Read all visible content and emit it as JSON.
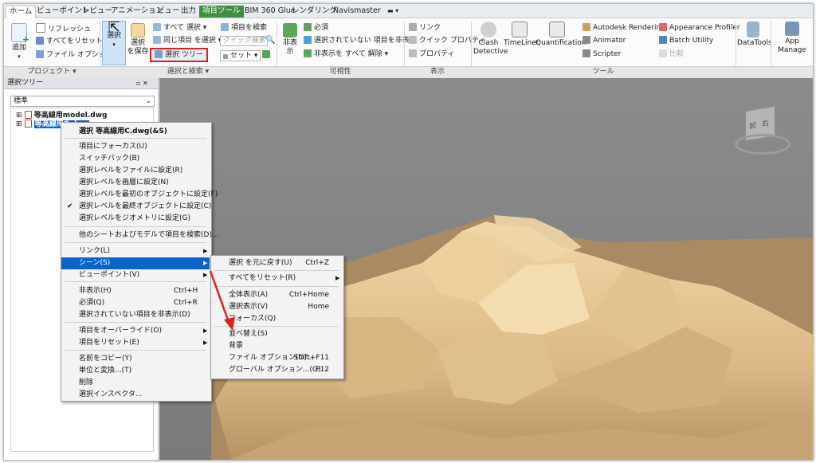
{
  "tabs": [
    "ホーム",
    "ビューポイント",
    "レビュー",
    "アニメーション",
    "ビュー",
    "出力",
    "項目ツール",
    "BIM 360 Glue",
    "レンダリング",
    "Navismaster"
  ],
  "ribbon": {
    "project": {
      "add": "追加",
      "refresh": "リフレッシュ",
      "reset_all": "すべてをリセット",
      "file_options": "ファイル オプション",
      "group": "プロジェクト"
    },
    "select_search": {
      "select": "選択",
      "save_sel_1": "選択",
      "save_sel_2": "を保存",
      "select_all": "すべて 選択",
      "select_same": "同じ項目 を選択",
      "select_tree": "選択 ツリー",
      "find_items": "項目を検索",
      "quick_find_placeholder": "クイック検索",
      "sets": "セット",
      "group": "選択と検索"
    },
    "visibility": {
      "hide": "非表示",
      "required": "必須",
      "hide_unselected": "選択されていない 項目を非表示",
      "unhide_all": "非表示を すべて 解除",
      "group": "可視性"
    },
    "display": {
      "links": "リンク",
      "quick_props": "クイック プロパティ",
      "properties": "プロパティ",
      "group": "表示"
    },
    "tools": {
      "clash": "Clash",
      "detective": "Detective",
      "timeliner": "TimeLiner",
      "quantification": "Quantification",
      "autodesk_rendering": "Autodesk Rendering",
      "animator": "Animator",
      "scripter": "Scripter",
      "appearance_profiler": "Appearance Profiler",
      "batch_utility": "Batch Utility",
      "compare": "比較",
      "group": "ツール"
    },
    "datatools": "DataTools",
    "appmanager": "App Manage"
  },
  "panel": {
    "title": "選択ツリー",
    "combo": "標準",
    "node1": "等高線用model.dwg",
    "node2": "等高線用C.dwg"
  },
  "context_menu": {
    "items": [
      {
        "label": "選択 等高線用C.dwg(&S)",
        "bold": true
      },
      {
        "label": "項目にフォーカス(U)"
      },
      {
        "label": "スイッチバック(B)"
      },
      {
        "label": "選択レベルをファイルに設定(R)"
      },
      {
        "label": "選択レベルを画層に設定(N)"
      },
      {
        "label": "選択レベルを最初のオブジェクトに設定(F)"
      },
      {
        "label": "選択レベルを最終オブジェクトに設定(C)",
        "check": true
      },
      {
        "label": "選択レベルをジオメトリに設定(G)"
      },
      {
        "label": "他のシートおよびモデルで項目を検索(D)..."
      },
      {
        "label": "リンク(L)",
        "sub": true
      },
      {
        "label": "シーン(S)",
        "sub": true,
        "hl": true
      },
      {
        "label": "ビューポイント(V)",
        "sub": true
      },
      {
        "label": "非表示(H)",
        "key": "Ctrl+H"
      },
      {
        "label": "必須(Q)",
        "key": "Ctrl+R"
      },
      {
        "label": "選択されていない項目を非表示(D)"
      },
      {
        "label": "項目をオーバーライド(O)",
        "sub": true
      },
      {
        "label": "項目をリセット(E)",
        "sub": true
      },
      {
        "label": "名前をコピー(Y)"
      },
      {
        "label": "単位と変換...(T)"
      },
      {
        "label": "削除"
      },
      {
        "label": "選択インスペクタ..."
      }
    ]
  },
  "submenu": {
    "items": [
      {
        "label": "選択 を元に戻す(U)",
        "key": "Ctrl+Z"
      },
      {
        "label": "すべてをリセット(R)",
        "sub": true
      },
      {
        "label": "全体表示(A)",
        "key": "Ctrl+Home"
      },
      {
        "label": "選択表示(V)",
        "key": "Home"
      },
      {
        "label": "フォーカス(Q)"
      },
      {
        "label": "並べ替え(S)"
      },
      {
        "label": "背景"
      },
      {
        "label": "ファイル オプション(O)...",
        "key": "Shift+F11"
      },
      {
        "label": "グローバル オプション...(G)",
        "key": "F12"
      }
    ]
  },
  "viewcube": {
    "front": "前",
    "right": "右"
  },
  "colors": {
    "highlight": "#0a63c9",
    "itemtools_tab": "#3f8f3f",
    "callout": "#e02020",
    "terrain": "#e8c79a"
  }
}
